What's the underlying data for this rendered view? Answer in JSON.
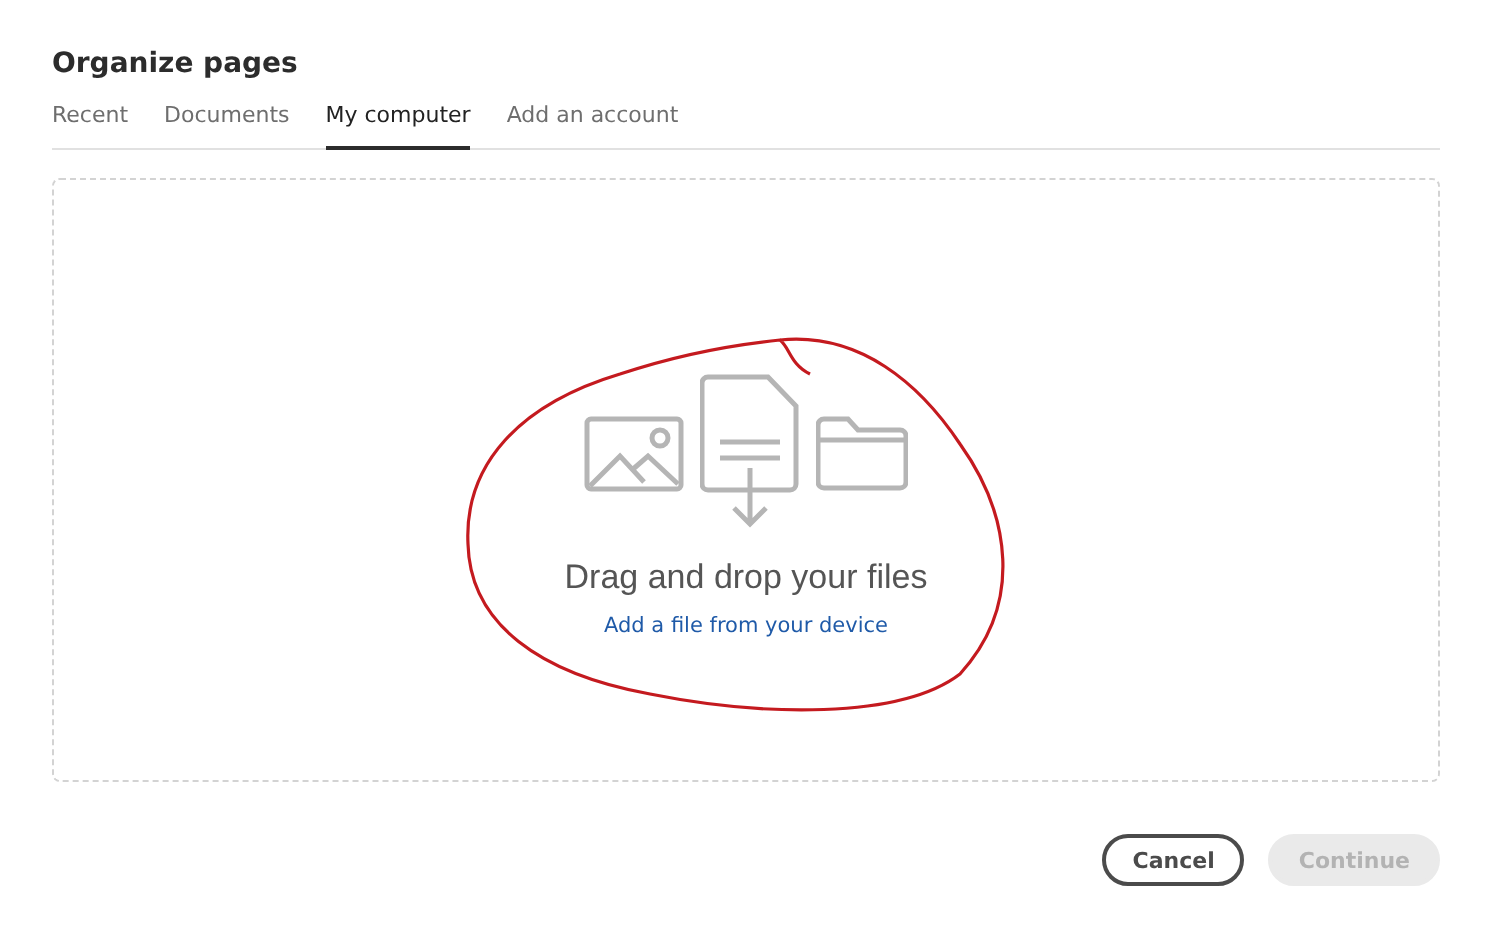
{
  "dialog": {
    "title": "Organize pages"
  },
  "tabs": [
    {
      "label": "Recent",
      "selected": false
    },
    {
      "label": "Documents",
      "selected": false
    },
    {
      "label": "My computer",
      "selected": true
    },
    {
      "label": "Add an account",
      "selected": false
    }
  ],
  "dropzone": {
    "heading": "Drag and drop your files",
    "link": "Add a file from your device"
  },
  "buttons": [
    {
      "label": "Cancel",
      "disabled": false,
      "kind": "secondary"
    },
    {
      "label": "Continue",
      "disabled": true,
      "kind": "primary"
    }
  ]
}
